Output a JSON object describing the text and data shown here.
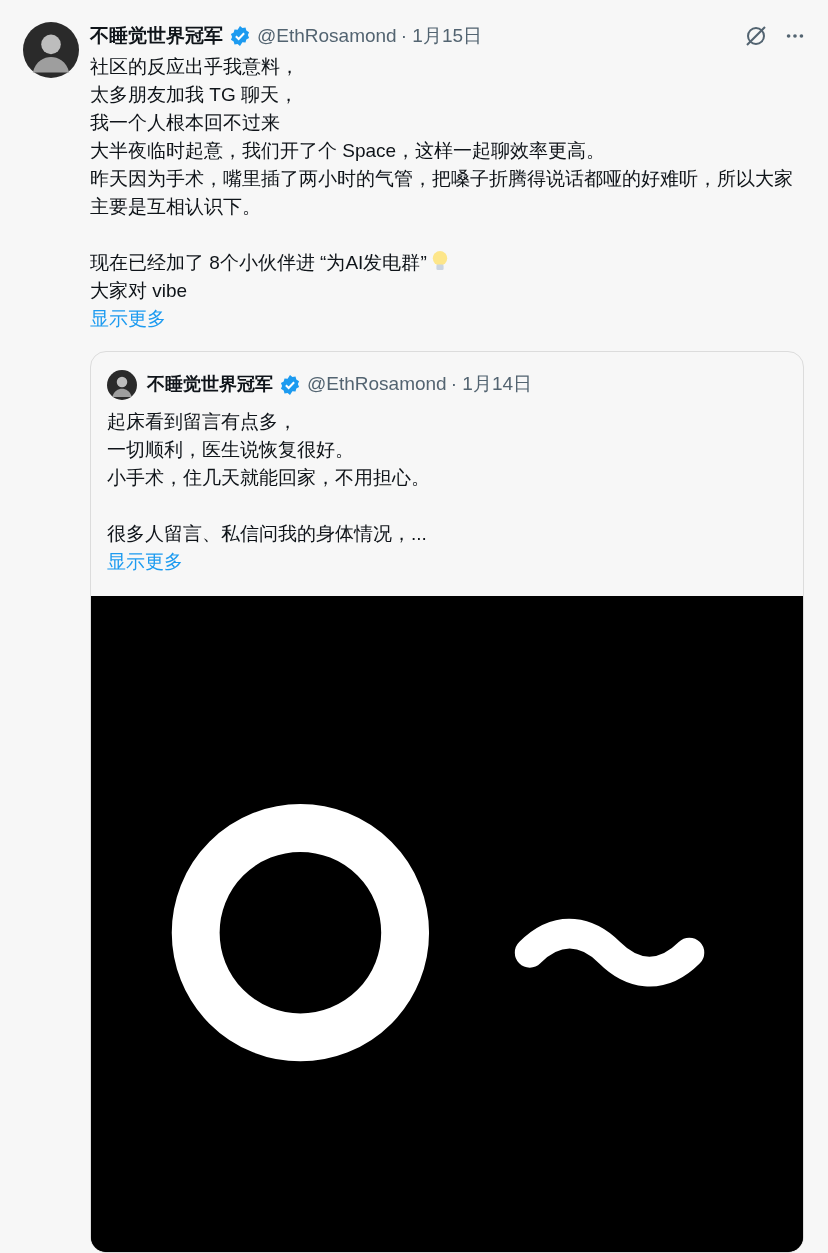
{
  "post": {
    "author": "不睡觉世界冠军",
    "verified": true,
    "handle": "@EthRosamond",
    "date": "· 1月15日",
    "paragraphs": [
      {
        "lines": [
          {
            "text": "社区的反应出乎我意料，"
          },
          {
            "text": "太多朋友加我 TG 聊天，"
          },
          {
            "text": "我一个人根本回不过来"
          },
          {
            "text": "大半夜临时起意，我们开了个 Space，这样一起聊效率更高。"
          },
          {
            "text": "昨天因为手术，嘴里插了两小时的气管，把嗓子折腾得说话都哑的好难听，所以大家主要是互相认识下。"
          }
        ]
      },
      {
        "lines": [
          {
            "text": "现在已经加了 8个小伙伴进 “为AI发电群”",
            "lightbulb": true
          },
          {
            "text": "大家对 vibe"
          }
        ]
      }
    ],
    "show_more": "显示更多",
    "quote": {
      "author": "不睡觉世界冠军",
      "verified": true,
      "handle": "@EthRosamond",
      "date": "· 1月14日",
      "paragraphs": [
        {
          "lines": [
            {
              "text": "起床看到留言有点多，"
            },
            {
              "text": "一切顺利，医生说恢复很好。"
            },
            {
              "text": "小手术，住几天就能回家，不用担心。"
            }
          ]
        },
        {
          "lines": [
            {
              "text": "很多人留言、私信问我的身体情况，..."
            }
          ]
        }
      ],
      "show_more": "显示更多"
    }
  }
}
